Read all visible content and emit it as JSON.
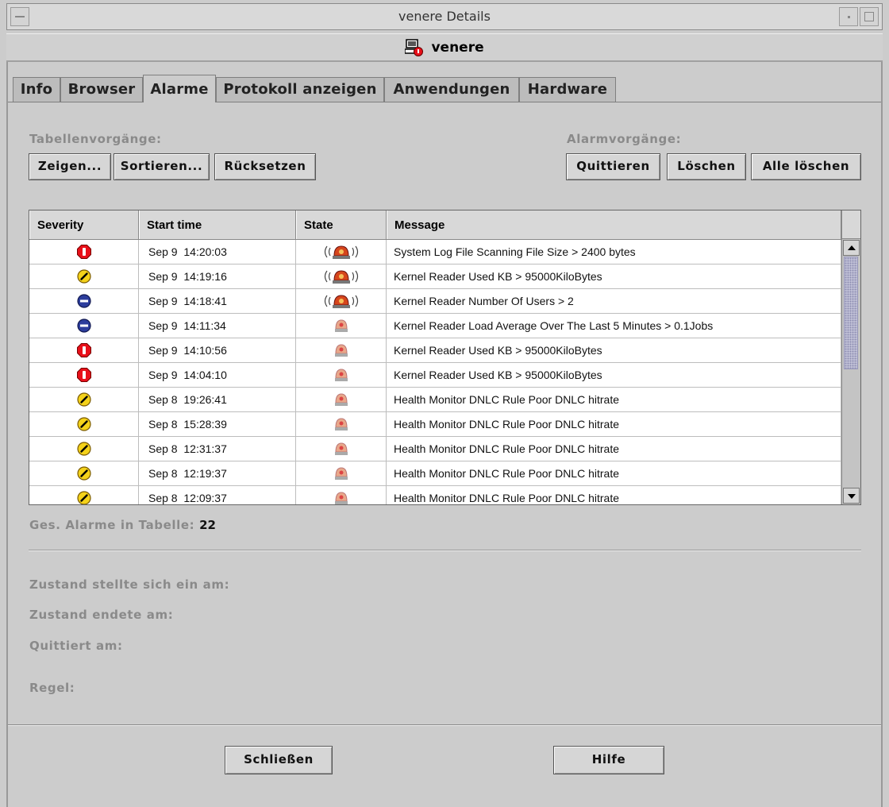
{
  "window": {
    "title": "venere Details"
  },
  "host": {
    "name": "venere",
    "icon": "host-alarm-icon"
  },
  "tabs": [
    {
      "label": "Info"
    },
    {
      "label": "Browser"
    },
    {
      "label": "Alarme"
    },
    {
      "label": "Protokoll anzeigen"
    },
    {
      "label": "Anwendungen"
    },
    {
      "label": "Hardware"
    }
  ],
  "active_tab": "Alarme",
  "table_ops": {
    "label": "Tabellenvorgänge:",
    "buttons": [
      "Zeigen...",
      "Sortieren...",
      "Rücksetzen"
    ]
  },
  "alarm_ops": {
    "label": "Alarmvorgänge:",
    "buttons": [
      "Quittieren",
      "Löschen",
      "Alle löschen"
    ]
  },
  "table": {
    "columns": [
      "Severity",
      "Start time",
      "State",
      "Message"
    ],
    "rows": [
      {
        "severity": "critical",
        "time": "Sep 9  14:20:03",
        "state": "open-active",
        "message": "System Log File Scanning File Size > 2400 bytes"
      },
      {
        "severity": "warning",
        "time": "Sep 9  14:19:16",
        "state": "open-active",
        "message": "Kernel Reader Used KB > 95000KiloBytes"
      },
      {
        "severity": "info",
        "time": "Sep 9  14:18:41",
        "state": "open-active",
        "message": "Kernel Reader Number Of Users > 2"
      },
      {
        "severity": "info",
        "time": "Sep 9  14:11:34",
        "state": "closed",
        "message": "Kernel Reader Load Average Over The Last 5 Minutes > 0.1Jobs"
      },
      {
        "severity": "critical",
        "time": "Sep 9  14:10:56",
        "state": "closed",
        "message": "Kernel Reader Used KB > 95000KiloBytes"
      },
      {
        "severity": "critical",
        "time": "Sep 9  14:04:10",
        "state": "closed",
        "message": "Kernel Reader Used KB > 95000KiloBytes"
      },
      {
        "severity": "warning",
        "time": "Sep 8  19:26:41",
        "state": "closed",
        "message": "Health Monitor DNLC Rule Poor DNLC hitrate"
      },
      {
        "severity": "warning",
        "time": "Sep 8  15:28:39",
        "state": "closed",
        "message": "Health Monitor DNLC Rule Poor DNLC hitrate"
      },
      {
        "severity": "warning",
        "time": "Sep 8  12:31:37",
        "state": "closed",
        "message": "Health Monitor DNLC Rule Poor DNLC hitrate"
      },
      {
        "severity": "warning",
        "time": "Sep 8  12:19:37",
        "state": "closed",
        "message": "Health Monitor DNLC Rule Poor DNLC hitrate"
      },
      {
        "severity": "warning",
        "time": "Sep 8  12:09:37",
        "state": "closed",
        "message": "Health Monitor DNLC Rule Poor DNLC hitrate"
      }
    ]
  },
  "total": {
    "label": "Ges. Alarme in Tabelle:",
    "value": "22"
  },
  "details": {
    "started": "Zustand stellte sich ein am:",
    "ended": "Zustand endete am:",
    "acknowledged": "Quittiert am:",
    "rule": "Regel:"
  },
  "footer": {
    "close_label": "Schließen",
    "help_label": "Hilfe"
  },
  "colors": {
    "critical": "#e8101a",
    "warning": "#f4d21a",
    "info": "#2c3d9c",
    "state_active": "#d6461c",
    "state_closed": "#e8a88a"
  }
}
